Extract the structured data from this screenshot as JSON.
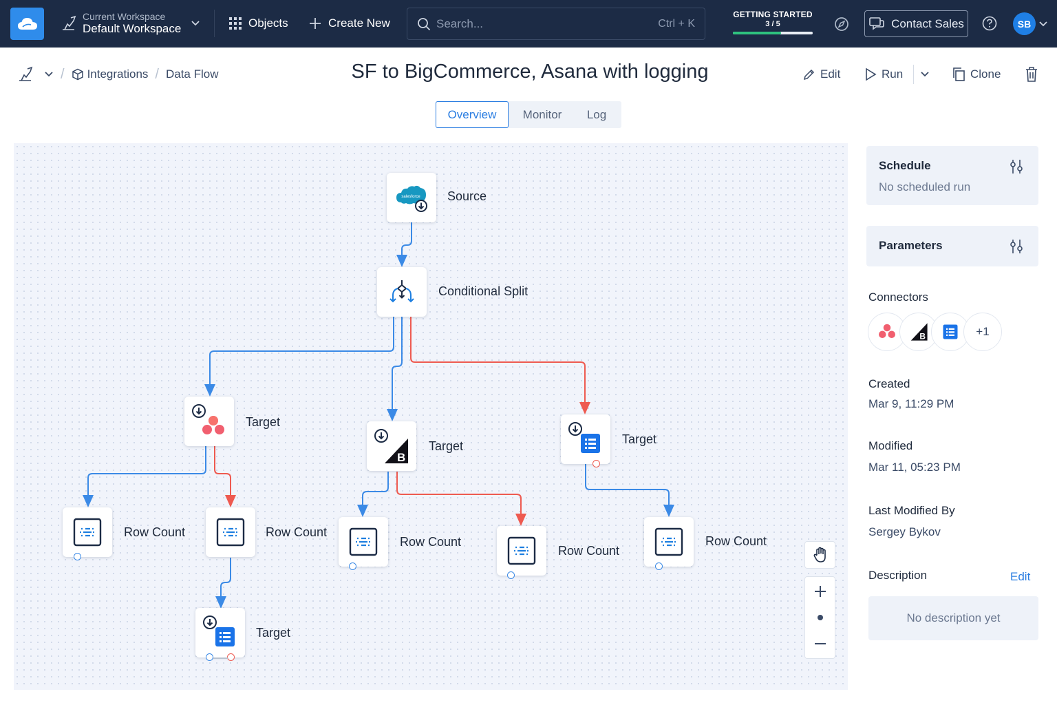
{
  "topbar": {
    "workspace_label": "Current Workspace",
    "workspace_name": "Default Workspace",
    "objects_label": "Objects",
    "create_label": "Create New",
    "search_placeholder": "Search...",
    "search_shortcut": "Ctrl + K",
    "getting_started_label": "GETTING STARTED",
    "getting_started_count": "3 / 5",
    "getting_started_progress": 0.6,
    "contact_label": "Contact Sales",
    "avatar_initials": "SB"
  },
  "breadcrumb": {
    "integrations": "Integrations",
    "current": "Data Flow"
  },
  "page": {
    "title": "SF to BigCommerce, Asana with logging",
    "edit_label": "Edit",
    "run_label": "Run",
    "clone_label": "Clone"
  },
  "tabs": [
    "Overview",
    "Monitor",
    "Log"
  ],
  "active_tab": "Overview",
  "flow": {
    "source": "Source",
    "split": "Conditional Split",
    "target_asana": "Target",
    "target_bigcommerce": "Target",
    "target_sheets": "Target",
    "target_bottom": "Target",
    "rowcount_1": "Row Count",
    "rowcount_2": "Row Count",
    "rowcount_3": "Row Count",
    "rowcount_4": "Row Count",
    "rowcount_5": "Row Count",
    "salesforce_logo_text": "salesforce"
  },
  "panel": {
    "schedule_title": "Schedule",
    "schedule_value": "No scheduled run",
    "parameters_title": "Parameters",
    "connectors_title": "Connectors",
    "connectors_more": "+1",
    "created_title": "Created",
    "created_value": "Mar 9, 11:29 PM",
    "modified_title": "Modified",
    "modified_value": "Mar 11, 05:23 PM",
    "modified_by_title": "Last Modified By",
    "modified_by_value": "Sergey Bykov",
    "description_title": "Description",
    "description_edit": "Edit",
    "description_value": "No description yet"
  },
  "colors": {
    "topbar": "#1c2b45",
    "accent": "#2a7de1",
    "wire_blue": "#3b8ae6",
    "wire_red": "#ee5a50"
  }
}
